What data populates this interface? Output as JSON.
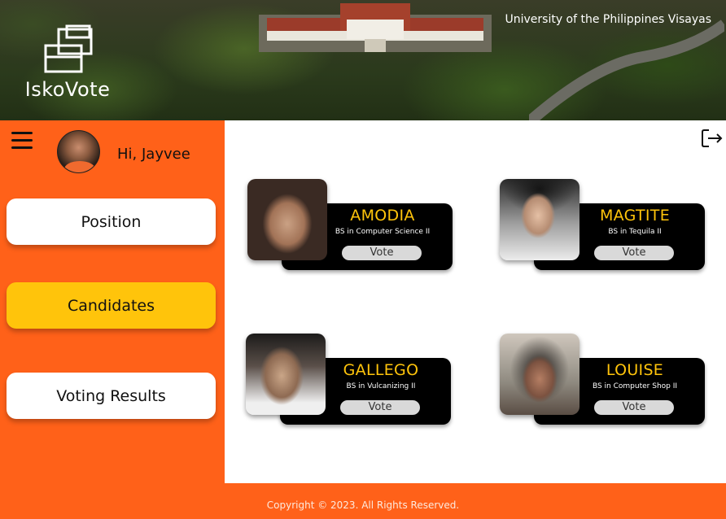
{
  "header": {
    "brand": "IskoVote",
    "university": "University of the Philippines Visayas",
    "logo_icon": "ballot-box-icon"
  },
  "sidebar": {
    "greeting": "Hi, Jayvee",
    "menu_icon": "hamburger-icon",
    "items": [
      {
        "label": "Position",
        "active": false
      },
      {
        "label": "Candidates",
        "active": true
      },
      {
        "label": "Voting Results",
        "active": false
      }
    ]
  },
  "main": {
    "logout_icon": "logout-icon",
    "candidates": [
      {
        "name": "AMODIA",
        "course": "BS in Computer Science II",
        "vote_label": "Vote"
      },
      {
        "name": "MAGTITE",
        "course": "BS in Tequila II",
        "vote_label": "Vote"
      },
      {
        "name": "GALLEGO",
        "course": "BS in Vulcanizing II",
        "vote_label": "Vote"
      },
      {
        "name": "LOUISE",
        "course": "BS in Computer Shop II",
        "vote_label": "Vote"
      }
    ]
  },
  "footer": {
    "copyright": "Copyright © 2023. All Rights Reserved."
  },
  "colors": {
    "accent_orange": "#ff6119",
    "active_yellow": "#ffc40b",
    "card_black": "#000000"
  }
}
